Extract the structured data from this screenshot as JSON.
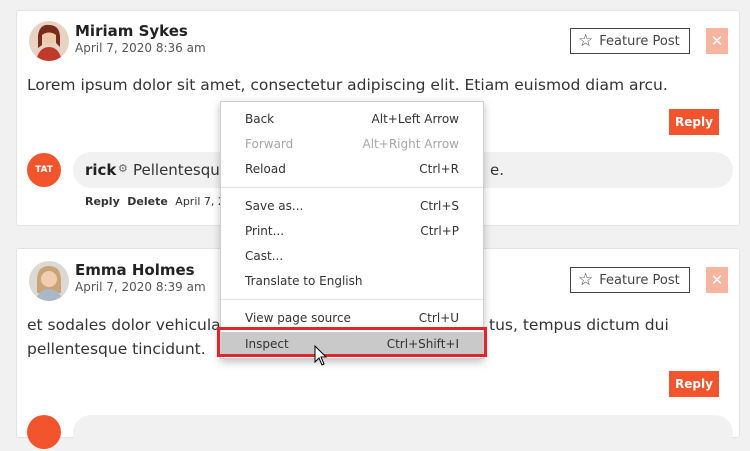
{
  "posts": [
    {
      "author": "Miriam Sykes",
      "date": "April 7, 2020 8:36 am",
      "text": "Lorem ipsum dolor sit amet, consectetur adipiscing elit. Etiam euismod diam arcu.",
      "feature_label": "Feature Post",
      "close_label": "✕",
      "reply_label": "Reply",
      "comment": {
        "logo_text": "TAT",
        "author": "rick",
        "text_left": "Pellentesqu",
        "text_right": "e.",
        "meta_reply": "Reply",
        "meta_delete": "Delete",
        "meta_date": "April 7, 20"
      }
    },
    {
      "author": "Emma Holmes",
      "date": "April 7, 2020 8:39 am",
      "text_line1_left": "et sodales dolor vehicula",
      "text_line1_right": "tus, tempus dictum dui",
      "text_line2": "pellentesque tincidunt.",
      "feature_label": "Feature Post",
      "close_label": "✕",
      "reply_label": "Reply"
    }
  ],
  "context_menu": {
    "items": [
      {
        "label": "Back",
        "shortcut": "Alt+Left Arrow",
        "disabled": false
      },
      {
        "label": "Forward",
        "shortcut": "Alt+Right Arrow",
        "disabled": true
      },
      {
        "label": "Reload",
        "shortcut": "Ctrl+R",
        "disabled": false
      },
      {
        "label": "Save as...",
        "shortcut": "Ctrl+S",
        "disabled": false
      },
      {
        "label": "Print...",
        "shortcut": "Ctrl+P",
        "disabled": false
      },
      {
        "label": "Cast...",
        "shortcut": "",
        "disabled": false
      },
      {
        "label": "Translate to English",
        "shortcut": "",
        "disabled": false
      },
      {
        "label": "View page source",
        "shortcut": "Ctrl+U",
        "disabled": false
      },
      {
        "label": "Inspect",
        "shortcut": "Ctrl+Shift+I",
        "disabled": false
      }
    ]
  },
  "colors": {
    "accent": "#f2542d",
    "close_bg": "#f5b59e",
    "highlight_border": "#e0262a"
  }
}
